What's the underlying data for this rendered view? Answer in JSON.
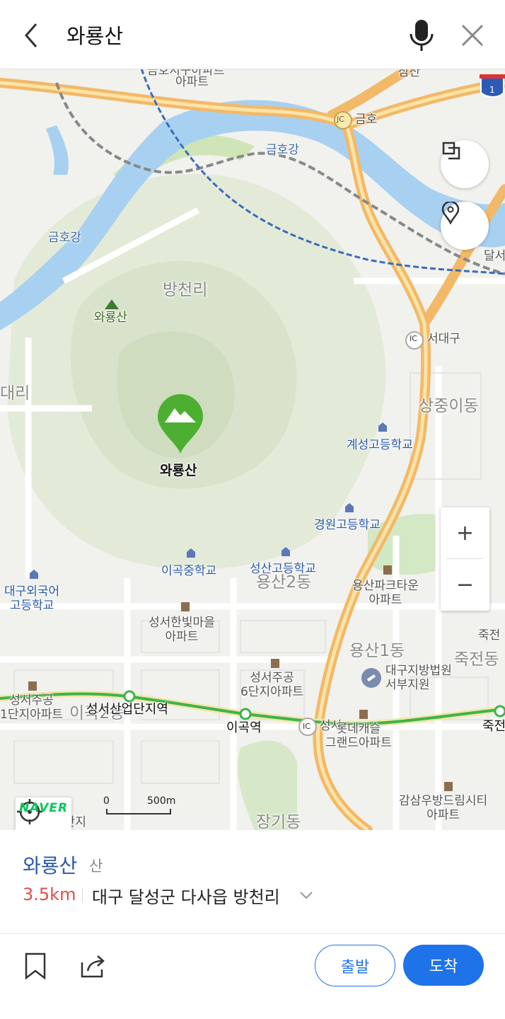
{
  "search": {
    "query": "와룡산"
  },
  "map": {
    "selected_marker": {
      "label": "와룡산",
      "icon": "mountain-pin-icon"
    },
    "labels": {
      "geumho_apt": "아파트",
      "geumho_apt_top": "금호지구아파트",
      "samsan": "삼산",
      "highway_shield": "1",
      "jc_badge": "JC",
      "geumho": "금호",
      "river1": "금호강",
      "river2": "금호강",
      "dalseo": "달서",
      "bangcheonri": "방천리",
      "peak": "와룡산",
      "ic_badge": "IC",
      "seodaegu": "서대구",
      "daeri": "대리",
      "sangjung": "상중이동",
      "gyeseong": "계성고등학교",
      "gyeongwon": "경원고등학교",
      "igok_middle": "이곡중학교",
      "seongsan_high": "성산고등학교",
      "yongsan2": "용산2동",
      "yongsan_park": "용산파크타운\n아파트",
      "daegu_foreign": "대구외국어\n고등학교",
      "hanbit": "성서한빛마을\n아파트",
      "jukjeon_top": "죽전",
      "yongsan1": "용산1동",
      "jukjeon_dong": "죽전동",
      "court": "대구지방법원\n서부지원",
      "seongseo6": "성서주공\n6단지아파트",
      "seongseo1": "성서주공\n1단지아파트",
      "igok2": "이곡2동",
      "station_sandan": "성서산업단지역",
      "station_igok": "이곡역",
      "ic_badge2": "IC",
      "seongseo_ic": "성서",
      "lotte": "롯데캐슬\n그랜드아파트",
      "jukjeon_station": "죽전",
      "gamsam": "감삼우방드림시티\n아파트",
      "ilban": "일반산업단지",
      "janggi": "장기동"
    },
    "scale": {
      "zero": "0",
      "distance": "500m"
    },
    "brand": "NAVER",
    "zoom_in": "+",
    "zoom_out": "−"
  },
  "place": {
    "name": "와룡산",
    "category": "산",
    "distance": "3.5km",
    "address": "대구 달성군 다사읍 방천리"
  },
  "actions": {
    "depart": "출발",
    "arrive": "도착"
  },
  "colors": {
    "accent": "#1e73e8",
    "distance": "#e04e4e",
    "marker": "#4caf32",
    "road": "#f6c67f",
    "water": "#a8d0f0"
  }
}
